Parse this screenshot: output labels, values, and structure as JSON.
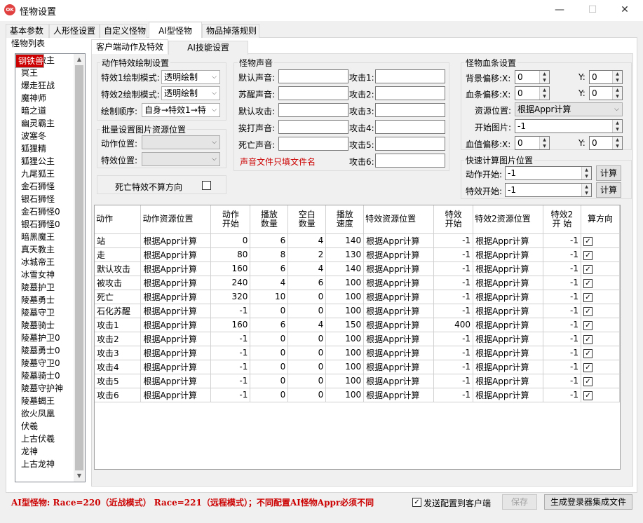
{
  "window": {
    "title": "怪物设置",
    "icon_text": "OK",
    "min": "—",
    "max": "☐",
    "close": "✕"
  },
  "main_tabs": [
    {
      "label": "基本参数"
    },
    {
      "label": "人形怪设置"
    },
    {
      "label": "自定义怪物"
    },
    {
      "label": "AI型怪物"
    },
    {
      "label": "物品掉落规则"
    }
  ],
  "monster_list": {
    "label": "怪物列表",
    "items": [
      "钢铁兽",
      "红袍教主",
      "冥王",
      "爆走狂战",
      "魔神师",
      "暗之道",
      "幽灵霸主",
      "波塞冬",
      "狐狸精",
      "狐狸公主",
      "九尾狐王",
      "金石狮怪",
      "银石狮怪",
      "金石狮怪0",
      "银石狮怪0",
      "暗黑魔王",
      "真天教主",
      "冰城帝王",
      "冰雪女神",
      "陵墓护卫",
      "陵墓勇士",
      "陵墓守卫",
      "陵墓骑士",
      "陵墓护卫0",
      "陵墓勇士0",
      "陵墓守卫0",
      "陵墓骑士0",
      "陵墓守护神",
      "陵墓蝎王",
      "欲火凤凰",
      "伏羲",
      "上古伏羲",
      "龙神",
      "上古龙神"
    ],
    "selected_index": 0
  },
  "sub_tabs": [
    {
      "label": "客户端动作及特效"
    },
    {
      "label": "AI技能设置"
    }
  ],
  "effect_group": {
    "title": "动作特效绘制设置",
    "mode1_label": "特效1绘制模式:",
    "mode1_value": "透明绘制",
    "mode2_label": "特效2绘制模式:",
    "mode2_value": "透明绘制",
    "order_label": "绘制顺序:",
    "order_value": "自身→特效1→特"
  },
  "batch_group": {
    "title": "批量设置图片资源位置",
    "action_label": "动作位置:",
    "effect_label": "特效位置:"
  },
  "death_effect": {
    "label": "死亡特效不算方向",
    "checked": false
  },
  "sound_group": {
    "title": "怪物声音",
    "left": [
      "默认声音:",
      "苏醒声音:",
      "默认攻击:",
      "挨打声音:",
      "死亡声音:"
    ],
    "right": [
      "攻击1:",
      "攻击2:",
      "攻击3:",
      "攻击4:",
      "攻击5:",
      "攻击6:"
    ],
    "note": "声音文件只填文件名"
  },
  "hp_group": {
    "title": "怪物血条设置",
    "bg_label": "背景偏移:X:",
    "bg_x": "0",
    "bg_y": "0",
    "bar_label": "血条偏移:X:",
    "bar_x": "0",
    "bar_y": "0",
    "y_label": "Y:",
    "res_label": "资源位置:",
    "res_value": "根据Appr计算",
    "start_label": "开始图片:",
    "start_value": "-1",
    "hpval_label": "血值偏移:X:",
    "hpval_x": "0",
    "hpval_y": "0"
  },
  "quick_group": {
    "title": "快速计算图片位置",
    "action_label": "动作开始:",
    "action_value": "-1",
    "effect_label": "特效开始:",
    "effect_value": "-1",
    "calc": "计算"
  },
  "table": {
    "headers": [
      "动作",
      "动作资源位置",
      "动作\n开始",
      "播放\n数量",
      "空白\n数量",
      "播放\n速度",
      "特效资源位置",
      "特效\n开始",
      "特效2资源位置",
      "特效2\n开 始",
      "算方向"
    ],
    "rows": [
      [
        "站",
        "根据Appr计算",
        "0",
        "6",
        "4",
        "140",
        "根据Appr计算",
        "-1",
        "根据Appr计算",
        "-1",
        true
      ],
      [
        "走",
        "根据Appr计算",
        "80",
        "8",
        "2",
        "130",
        "根据Appr计算",
        "-1",
        "根据Appr计算",
        "-1",
        true
      ],
      [
        "默认攻击",
        "根据Appr计算",
        "160",
        "6",
        "4",
        "140",
        "根据Appr计算",
        "-1",
        "根据Appr计算",
        "-1",
        true
      ],
      [
        "被攻击",
        "根据Appr计算",
        "240",
        "4",
        "6",
        "100",
        "根据Appr计算",
        "-1",
        "根据Appr计算",
        "-1",
        true
      ],
      [
        "死亡",
        "根据Appr计算",
        "320",
        "10",
        "0",
        "100",
        "根据Appr计算",
        "-1",
        "根据Appr计算",
        "-1",
        true
      ],
      [
        "石化苏醒",
        "根据Appr计算",
        "-1",
        "0",
        "0",
        "100",
        "根据Appr计算",
        "-1",
        "根据Appr计算",
        "-1",
        true
      ],
      [
        "攻击1",
        "根据Appr计算",
        "160",
        "6",
        "4",
        "150",
        "根据Appr计算",
        "400",
        "根据Appr计算",
        "-1",
        true
      ],
      [
        "攻击2",
        "根据Appr计算",
        "-1",
        "0",
        "0",
        "100",
        "根据Appr计算",
        "-1",
        "根据Appr计算",
        "-1",
        true
      ],
      [
        "攻击3",
        "根据Appr计算",
        "-1",
        "0",
        "0",
        "100",
        "根据Appr计算",
        "-1",
        "根据Appr计算",
        "-1",
        true
      ],
      [
        "攻击4",
        "根据Appr计算",
        "-1",
        "0",
        "0",
        "100",
        "根据Appr计算",
        "-1",
        "根据Appr计算",
        "-1",
        true
      ],
      [
        "攻击5",
        "根据Appr计算",
        "-1",
        "0",
        "0",
        "100",
        "根据Appr计算",
        "-1",
        "根据Appr计算",
        "-1",
        true
      ],
      [
        "攻击6",
        "根据Appr计算",
        "-1",
        "0",
        "0",
        "100",
        "根据Appr计算",
        "-1",
        "根据Appr计算",
        "-1",
        true
      ]
    ]
  },
  "footer": {
    "message": "AI型怪物: Race=220（近战模式） Race=221（远程模式）；不同配置AI怪物Appr必须不同",
    "send_label": "发送配置到客户端",
    "send_checked": true,
    "save": "保存",
    "generate": "生成登录器集成文件"
  }
}
